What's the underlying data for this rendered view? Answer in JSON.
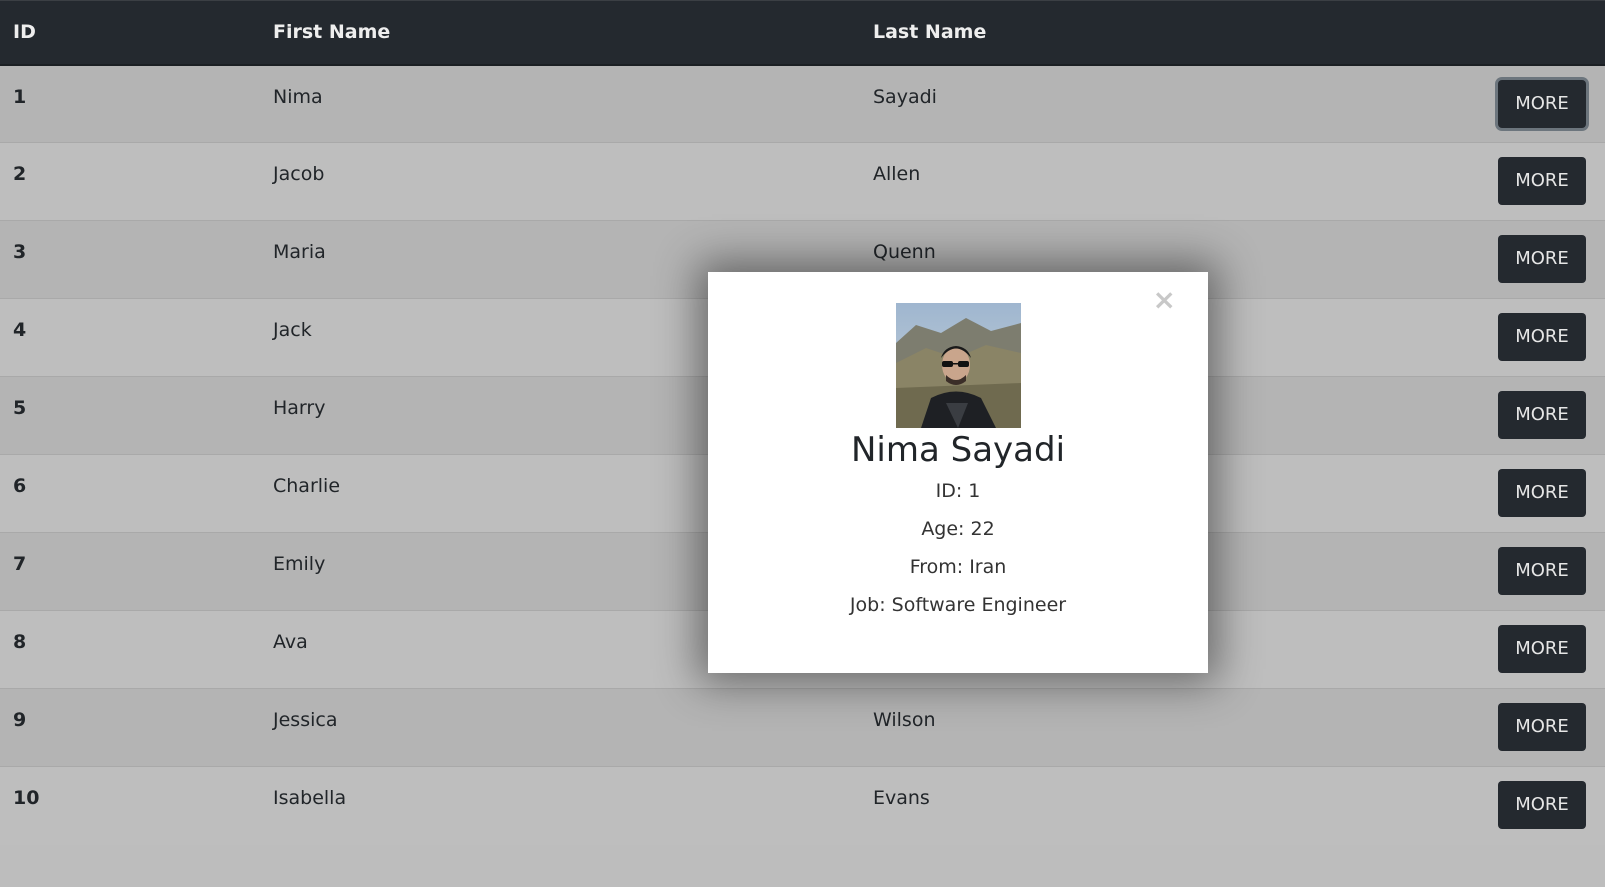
{
  "table": {
    "headers": {
      "id": "ID",
      "first_name": "First Name",
      "last_name": "Last Name"
    },
    "rows": [
      {
        "id": "1",
        "first": "Nima",
        "last": "Sayadi",
        "action": "MORE"
      },
      {
        "id": "2",
        "first": "Jacob",
        "last": "Allen",
        "action": "MORE"
      },
      {
        "id": "3",
        "first": "Maria",
        "last": "Quenn",
        "action": "MORE"
      },
      {
        "id": "4",
        "first": "Jack",
        "last": "",
        "action": "MORE"
      },
      {
        "id": "5",
        "first": "Harry",
        "last": "",
        "action": "MORE"
      },
      {
        "id": "6",
        "first": "Charlie",
        "last": "",
        "action": "MORE"
      },
      {
        "id": "7",
        "first": "Emily",
        "last": "",
        "action": "MORE"
      },
      {
        "id": "8",
        "first": "Ava",
        "last": "",
        "action": "MORE"
      },
      {
        "id": "9",
        "first": "Jessica",
        "last": "Wilson",
        "action": "MORE"
      },
      {
        "id": "10",
        "first": "Isabella",
        "last": "Evans",
        "action": "MORE"
      }
    ]
  },
  "modal": {
    "close_icon": "×",
    "avatar_icon": "profile-photo",
    "name": "Nima Sayadi",
    "id_line": "ID: 1",
    "age_line": "Age: 22",
    "from_line": "From: Iran",
    "job_line": "Job: Software Engineer"
  },
  "colors": {
    "header_bg": "#24292f",
    "button_bg": "#24292f",
    "overlay_row_dark": "#b4b4b4",
    "overlay_row_light": "#bebebe"
  }
}
